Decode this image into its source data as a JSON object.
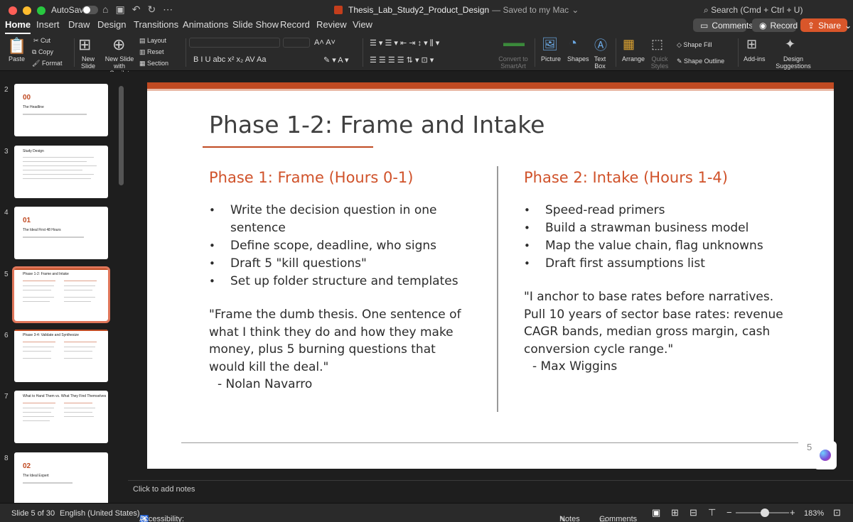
{
  "window": {
    "autosave_label": "AutoSave",
    "doc_title": "Thesis_Lab_Study2_Product_Design",
    "save_status": "— Saved to my Mac",
    "search_placeholder": "Search (Cmd + Ctrl + U)"
  },
  "tabs": [
    {
      "label": "Home",
      "active": true
    },
    {
      "label": "Insert"
    },
    {
      "label": "Draw"
    },
    {
      "label": "Design"
    },
    {
      "label": "Transitions"
    },
    {
      "label": "Animations"
    },
    {
      "label": "Slide Show"
    },
    {
      "label": "Record"
    },
    {
      "label": "Review"
    },
    {
      "label": "View"
    }
  ],
  "top_buttons": {
    "comments": "Comments",
    "record": "Record",
    "share": "Share"
  },
  "ribbon": {
    "paste": "Paste",
    "cut": "Cut",
    "copy": "Copy",
    "format": "Format",
    "new_slide": "New Slide",
    "new_slide_copilot": "New Slide with Copilot",
    "layout": "Layout",
    "reset": "Reset",
    "section": "Section",
    "convert_smartart": "Convert to SmartArt",
    "picture": "Picture",
    "shapes": "Shapes",
    "text_box": "Text Box",
    "arrange": "Arrange",
    "quick_styles": "Quick Styles",
    "shape_fill": "Shape Fill",
    "shape_outline": "Shape Outline",
    "add_ins": "Add-ins",
    "design_suggestions": "Design Suggestions"
  },
  "thumbnails": [
    {
      "num": "2",
      "title": "00",
      "subtitle": "The Headline",
      "type": "section"
    },
    {
      "num": "3",
      "title": "Study Design",
      "type": "text"
    },
    {
      "num": "4",
      "title": "01",
      "subtitle": "The Ideal First 48 Hours",
      "type": "section"
    },
    {
      "num": "5",
      "title": "Phase 1-2: Frame and Intake",
      "type": "two-col",
      "selected": true
    },
    {
      "num": "6",
      "title": "Phase 3-4: Validate and Synthesize",
      "type": "two-col"
    },
    {
      "num": "7",
      "title": "What to Hand Them vs. What They Find Themselves",
      "type": "two-col"
    },
    {
      "num": "8",
      "title": "02",
      "subtitle": "The Ideal Expert",
      "type": "section"
    }
  ],
  "slide": {
    "title": "Phase 1-2: Frame and Intake",
    "left": {
      "heading": "Phase 1: Frame (Hours 0-1)",
      "bullets": [
        "Write the decision question in one sentence",
        "Define scope, deadline, who signs",
        "Draft 5 \"kill questions\"",
        "Set up folder structure and templates"
      ],
      "quote_lines": [
        "\"Frame the dumb thesis. One sentence of",
        "what I think they do and how they make",
        "money, plus 5 burning questions that",
        "would kill the deal.\""
      ],
      "attribution": "- Nolan Navarro"
    },
    "right": {
      "heading": "Phase 2: Intake (Hours 1-4)",
      "bullets": [
        "Speed-read primers",
        "Build a strawman business model",
        "Map the value chain, flag unknowns",
        "Draft first assumptions list"
      ],
      "quote_lines": [
        "\"I anchor to base rates before narratives.",
        "Pull 10 years of sector base rates: revenue",
        "CAGR bands, median gross margin, cash",
        "conversion cycle range.\""
      ],
      "attribution": "- Max Wiggins"
    },
    "page_number": "5"
  },
  "notes_placeholder": "Click to add notes",
  "status": {
    "slide_pos": "Slide 5 of 30",
    "language": "English (United States)",
    "accessibility": "Accessibility: Investigate",
    "notes": "Notes",
    "comments": "Comments",
    "zoom": "183%",
    "zoom_level": 0.55
  },
  "colors": {
    "accent": "#c04a22",
    "heading": "#d0522a",
    "record_red": "#d9382a",
    "share_orange": "#d9562a"
  }
}
